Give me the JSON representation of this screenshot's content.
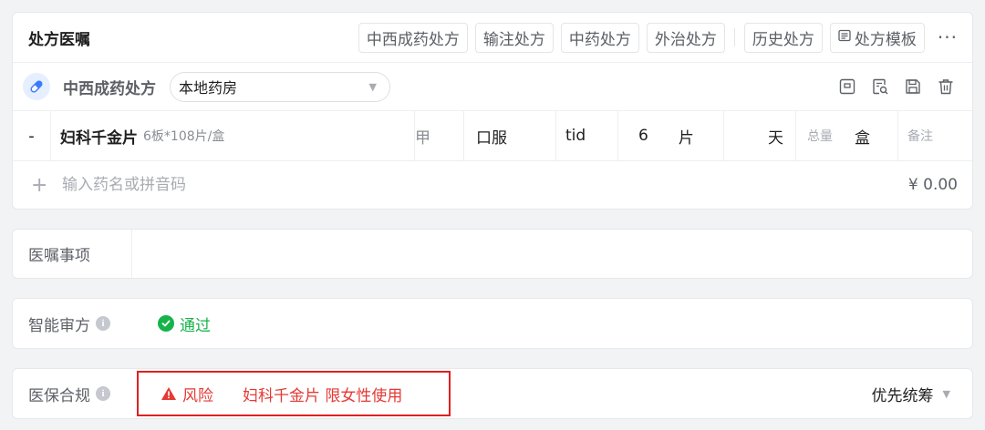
{
  "rx": {
    "title": "处方医嘱",
    "tabs": {
      "western_chinese": "中西成药处方",
      "infusion": "输注处方",
      "herbal": "中药处方",
      "external": "外治处方",
      "history": "历史处方",
      "template": "处方模板"
    },
    "type_label": "中西成药处方",
    "pharmacy": "本地药房"
  },
  "drug": {
    "minus": "-",
    "name": "妇科千金片",
    "spec": "6板*108片/盒",
    "grade": "甲",
    "route": "口服",
    "frequency": "tid",
    "dose": "6",
    "dose_unit": "片",
    "days_unit": "天",
    "total_label": "总量",
    "total_unit": "盒",
    "note_placeholder": "备注"
  },
  "add_row": {
    "plus": "+",
    "placeholder": "输入药名或拼音码",
    "price": "¥ 0.00"
  },
  "orders": {
    "label": "医嘱事项",
    "value": ""
  },
  "audit": {
    "label": "智能审方",
    "status": "通过"
  },
  "insurance": {
    "label": "医保合规",
    "risk_label": "风险",
    "risk_message": "妇科千金片 限女性使用",
    "funding": "优先统筹"
  },
  "colors": {
    "accent_blue": "#3b7cff",
    "pass_green": "#17b34a",
    "risk_red": "#e53935"
  }
}
